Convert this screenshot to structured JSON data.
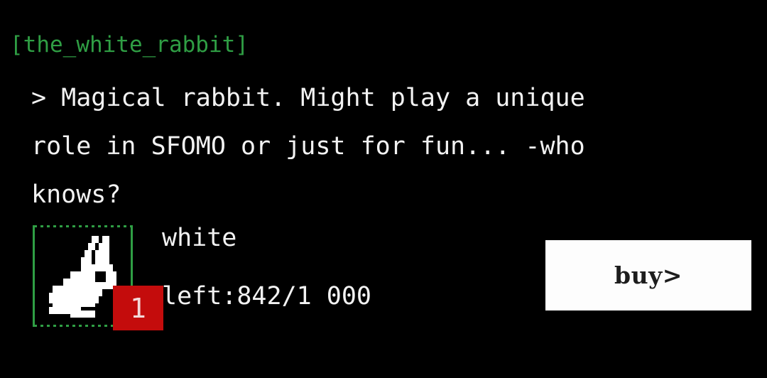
{
  "theme": {
    "background": "#000000",
    "accent_green": "#2f9e44",
    "text": "#f2f2f2",
    "badge_red": "#c40c0c",
    "button_bg": "#fdfdfd",
    "button_text": "#1d1d1d"
  },
  "header": {
    "title": "[the_white_rabbit]"
  },
  "description": {
    "lines": [
      "> Magical rabbit. Might play a unique",
      "role in SFOMO or just for fun... -who",
      "knows?"
    ]
  },
  "item": {
    "icon": "pixel-rabbit-icon",
    "name": "white",
    "count_badge": "1",
    "stock_label": "left:842/1 000",
    "stock_remaining": 842,
    "stock_total": 1000
  },
  "actions": {
    "buy_label": "buy>"
  }
}
